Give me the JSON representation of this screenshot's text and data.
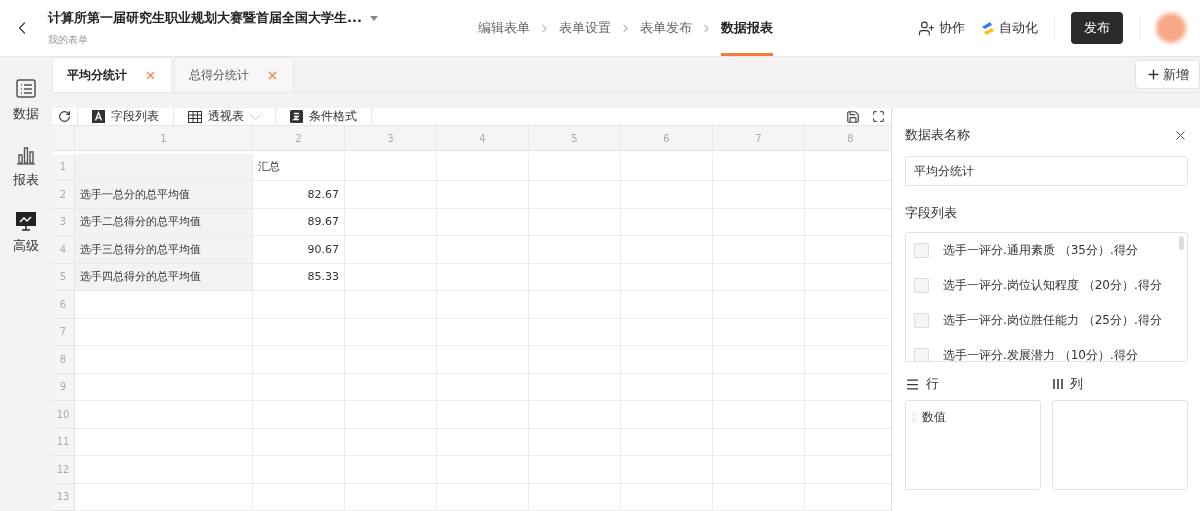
{
  "header": {
    "title": "计算所第一届研究生职业规划大赛暨首届全国大学生...",
    "subtitle": "我的表单",
    "steps": [
      {
        "label": "编辑表单",
        "selected": false
      },
      {
        "label": "表单设置",
        "selected": false
      },
      {
        "label": "表单发布",
        "selected": false
      },
      {
        "label": "数据报表",
        "selected": true
      }
    ],
    "collaborate": "协作",
    "automate": "自动化",
    "publish": "发布"
  },
  "sidebar": {
    "items": [
      {
        "label": "数据",
        "kind": "list"
      },
      {
        "label": "报表",
        "kind": "bars"
      },
      {
        "label": "高级",
        "kind": "board"
      }
    ]
  },
  "tabs": [
    {
      "label": "平均分统计",
      "selected": true
    },
    {
      "label": "总得分统计",
      "selected": false
    }
  ],
  "add_button": "新增",
  "toolbar": {
    "items": [
      {
        "label": "字段列表",
        "kind": "letter"
      },
      {
        "label": "透视表",
        "kind": "grid"
      },
      {
        "label": "条件格式",
        "kind": "format"
      }
    ]
  },
  "sheet": {
    "columns": [
      "1",
      "2",
      "3",
      "4",
      "5",
      "6",
      "7",
      "8"
    ],
    "rows": [
      {
        "number": "1",
        "kind": "heading",
        "value": "汇总"
      },
      {
        "number": "2",
        "kind": "data",
        "label": "选手一总分的总平均值",
        "value": "82.67"
      },
      {
        "number": "3",
        "kind": "data",
        "label": "选手二总得分的总平均值",
        "value": "89.67"
      },
      {
        "number": "4",
        "kind": "data",
        "label": "选手三总得分的总平均值",
        "value": "90.67"
      },
      {
        "number": "5",
        "kind": "data",
        "label": "选手四总得分的总平均值",
        "value": "85.33"
      },
      {
        "number": "6",
        "kind": "empty"
      },
      {
        "number": "7",
        "kind": "empty"
      },
      {
        "number": "8",
        "kind": "empty"
      },
      {
        "number": "9",
        "kind": "empty"
      },
      {
        "number": "10",
        "kind": "empty"
      },
      {
        "number": "11",
        "kind": "empty"
      },
      {
        "number": "12",
        "kind": "empty"
      },
      {
        "number": "13",
        "kind": "empty"
      }
    ]
  },
  "panel": {
    "name_label": "数据表名称",
    "name_value": "平均分统计",
    "fields_label": "字段列表",
    "fields": [
      {
        "label": "选手一评分.通用素质 （35分）.得分",
        "checked": false
      },
      {
        "label": "选手一评分.岗位认知程度 （20分）.得分",
        "checked": false
      },
      {
        "label": "选手一评分.岗位胜任能力 （25分）.得分",
        "checked": false
      },
      {
        "label": "选手一评分.发展潜力 （10分）.得分",
        "checked": false
      }
    ],
    "rows_label": "行",
    "columns_label": "列",
    "row_items": [
      "数值"
    ]
  }
}
